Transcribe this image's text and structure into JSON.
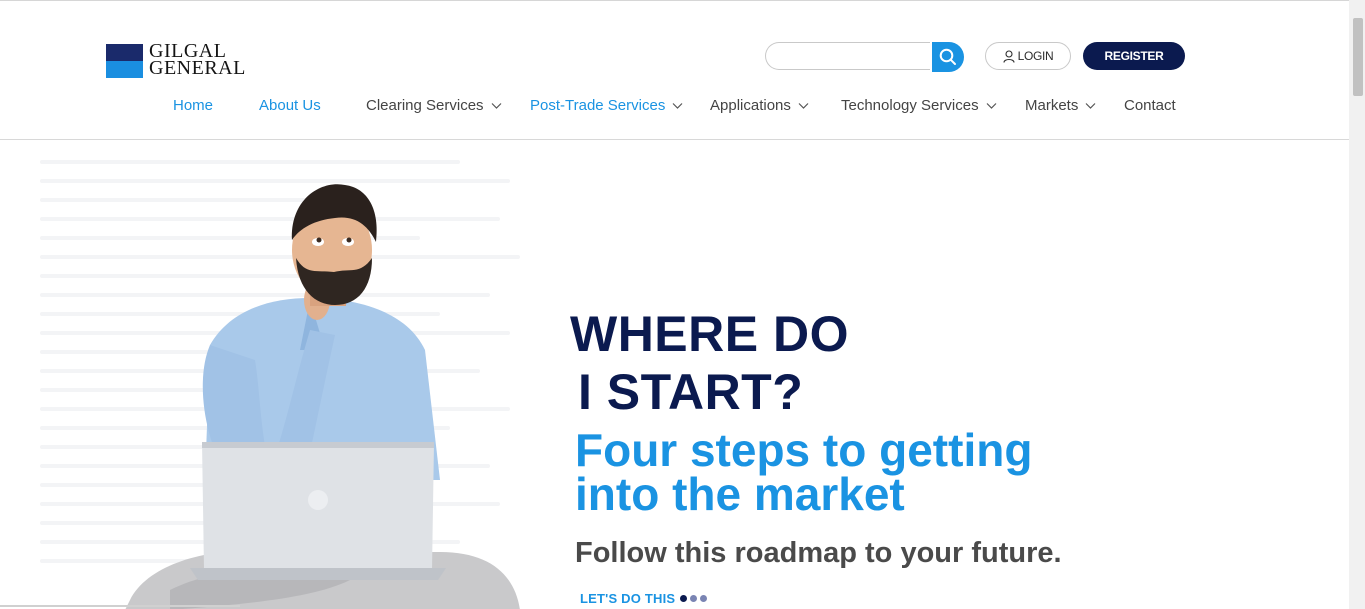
{
  "brand": {
    "line1": "GILGAL",
    "line2": "GENERAL"
  },
  "search": {
    "placeholder": "",
    "value": ""
  },
  "auth": {
    "login_label": "LOGIN",
    "register_label": "REGISTER"
  },
  "nav": {
    "items": [
      {
        "label": "Home",
        "dropdown": false,
        "active": true
      },
      {
        "label": "About Us",
        "dropdown": false,
        "active": true
      },
      {
        "label": "Clearing Services",
        "dropdown": true,
        "active": false
      },
      {
        "label": "Post-Trade Services",
        "dropdown": true,
        "active": true
      },
      {
        "label": "Applications",
        "dropdown": true,
        "active": false
      },
      {
        "label": "Technology Services",
        "dropdown": true,
        "active": false
      },
      {
        "label": "Markets",
        "dropdown": true,
        "active": false
      },
      {
        "label": "Contact",
        "dropdown": false,
        "active": false
      }
    ]
  },
  "hero": {
    "headline_line1": "WHERE DO",
    "headline_line2": "I START?",
    "subheadline_line1": "Four steps to getting",
    "subheadline_line2": "into the market",
    "tagline": "Follow this roadmap to your future.",
    "cta_label": "LET'S DO THIS",
    "slides": {
      "count": 3,
      "active_index": 0
    }
  },
  "colors": {
    "navy": "#0b1a4f",
    "accent_blue": "#1a93e2",
    "nav_text": "#444444",
    "dot_active": "#0b1a4f",
    "dot_inactive": "#7a84b3"
  },
  "icons": {
    "search": "search-icon",
    "user": "user-icon",
    "chevron": "chevron-down-icon"
  }
}
